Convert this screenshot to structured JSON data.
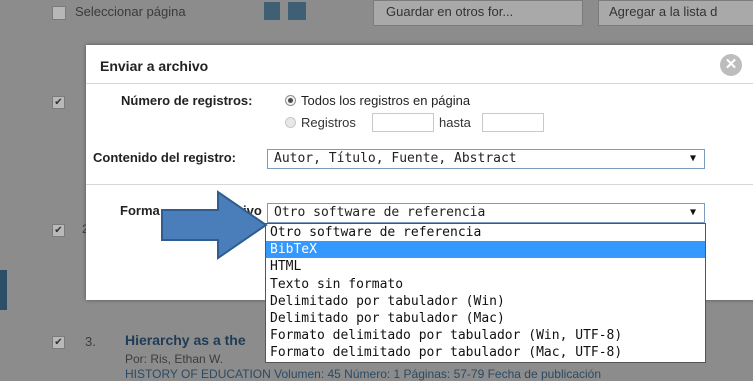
{
  "background": {
    "select_page_label": "Seleccionar página",
    "save_button_label": "Guardar en otros for...",
    "add_list_button_label": "Agregar a la lista d",
    "record_number": "3.",
    "record_title": "Hierarchy as a the",
    "record_author": "Por: Ris, Ethan W.",
    "record_source": "HISTORY OF EDUCATION   Volumen: 45   Número: 1   Páginas: 57-79   Fecha de publicación",
    "item2_number": "2"
  },
  "dialog": {
    "title": "Enviar a archivo",
    "close_icon": "x-icon",
    "records_label": "Número de registros:",
    "option_all": "Todos los registros en página",
    "option_range": "Registros",
    "range_to": "hasta",
    "content_label": "Contenido del registro:",
    "content_value": "Autor, Título, Fuente, Abstract",
    "format_label_left": "Forma",
    "format_label_right": "ivo",
    "format_value": "Otro software de referencia",
    "format_options": [
      "Otro software de referencia",
      "BibTeX",
      "HTML",
      "Texto sin formato",
      "Delimitado por tabulador (Win)",
      "Delimitado por tabulador (Mac)",
      "Formato delimitado por tabulador (Win, UTF-8)",
      "Formato delimitado por tabulador (Mac, UTF-8)"
    ],
    "highlighted_index": 1
  },
  "colors": {
    "overlay": "#8c8c8c",
    "highlight": "#3399ff",
    "arrow_fill": "#4a7ebb"
  }
}
